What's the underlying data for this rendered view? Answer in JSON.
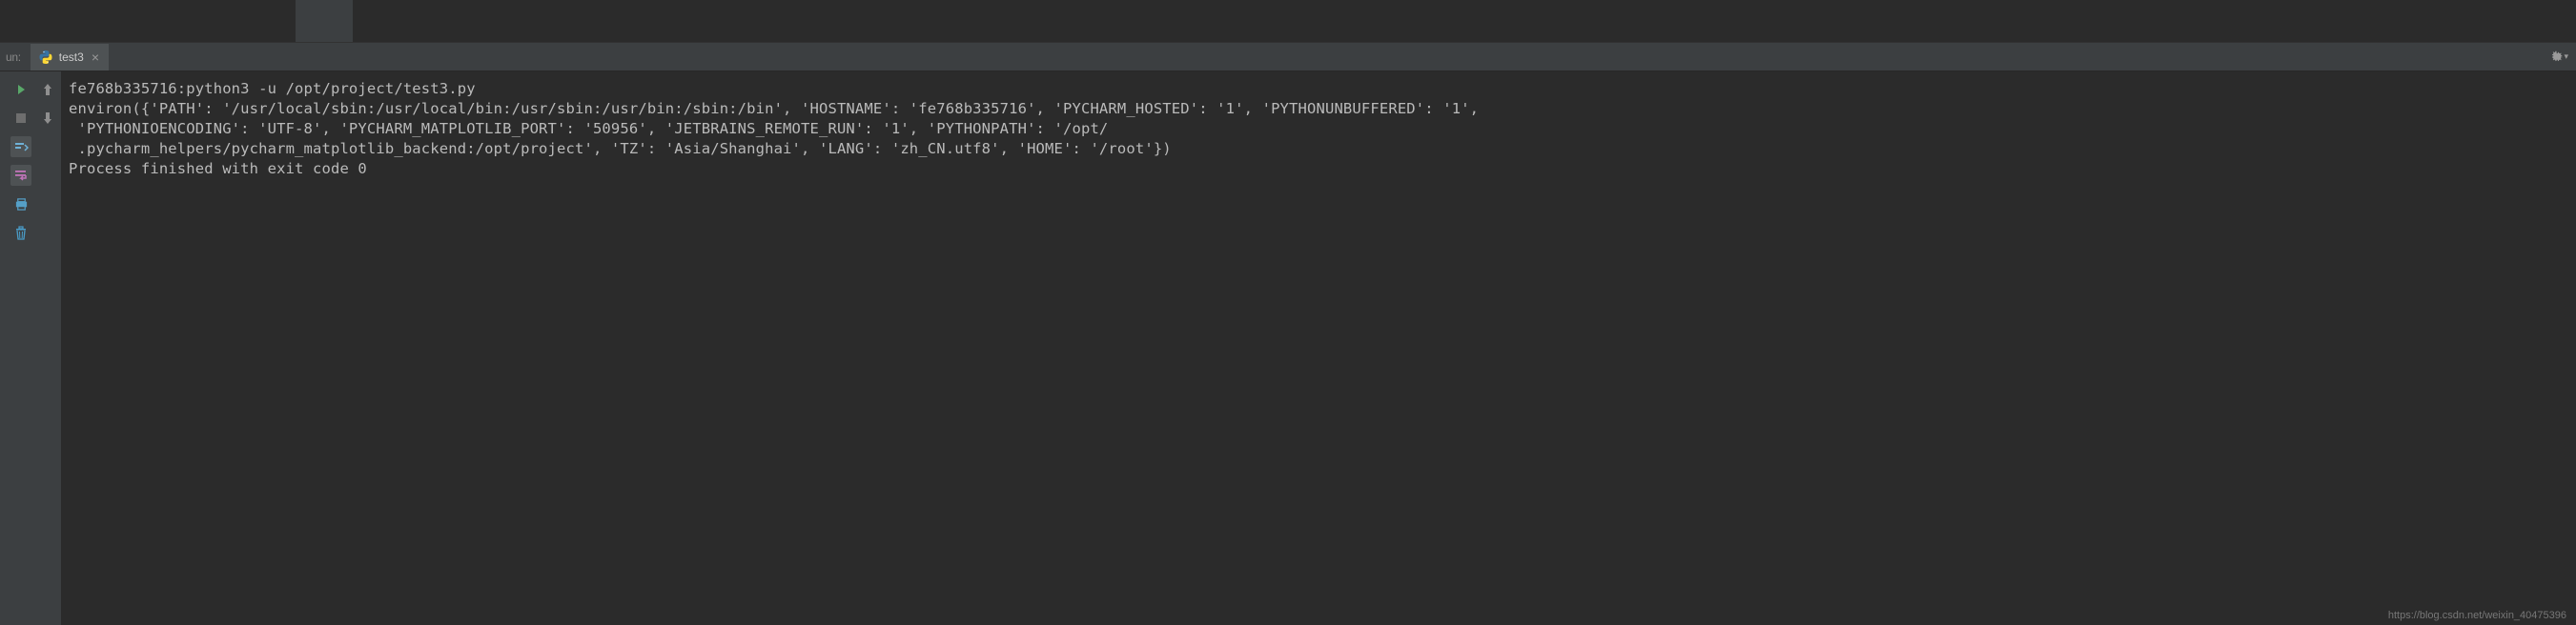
{
  "panel": {
    "label": "un:"
  },
  "tab": {
    "name": "test3",
    "close": "×"
  },
  "toolbar": {
    "play_tooltip": "Rerun",
    "stop_tooltip": "Stop"
  },
  "console": {
    "lines": [
      "fe768b335716:python3 -u /opt/project/test3.py",
      "environ({'PATH': '/usr/local/sbin:/usr/local/bin:/usr/sbin:/usr/bin:/sbin:/bin', 'HOSTNAME': 'fe768b335716', 'PYCHARM_HOSTED': '1', 'PYTHONUNBUFFERED': '1',",
      " 'PYTHONIOENCODING': 'UTF-8', 'PYCHARM_MATPLOTLIB_PORT': '50956', 'JETBRAINS_REMOTE_RUN': '1', 'PYTHONPATH': '/opt/",
      " .pycharm_helpers/pycharm_matplotlib_backend:/opt/project', 'TZ': 'Asia/Shanghai', 'LANG': 'zh_CN.utf8', 'HOME': '/root'})",
      "",
      "Process finished with exit code 0"
    ]
  },
  "watermark": "https://blog.csdn.net/weixin_40475396"
}
